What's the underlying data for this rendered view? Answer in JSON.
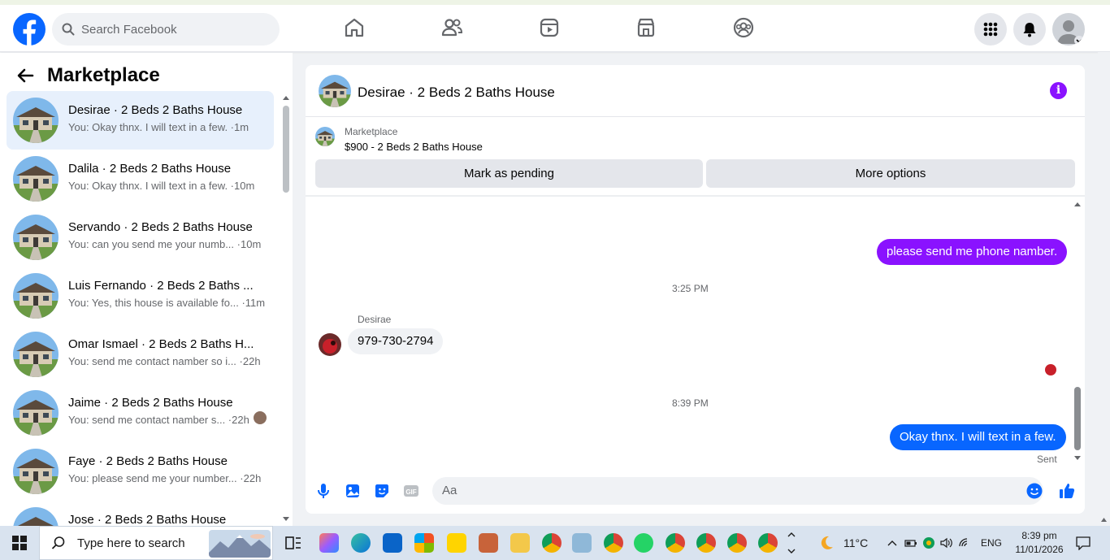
{
  "topbar": {
    "search_placeholder": "Search Facebook"
  },
  "left": {
    "title": "Marketplace",
    "conversations": [
      {
        "name": "Desirae · 2 Beds 2 Baths House",
        "preview": "You: Okay thnx. I will text in a few.",
        "time": "1m",
        "active": true
      },
      {
        "name": "Dalila · 2 Beds 2 Baths House",
        "preview": "You: Okay thnx. I will text in a few.",
        "time": "10m"
      },
      {
        "name": "Servando · 2 Beds 2 Baths House",
        "preview": "You: can you send me your numb...",
        "time": "10m"
      },
      {
        "name": "Luis Fernando · 2 Beds 2 Baths ...",
        "preview": "You: Yes, this house is available fo...",
        "time": "11m"
      },
      {
        "name": "Omar Ismael · 2 Beds 2 Baths H...",
        "preview": "You: send me contact namber so i...",
        "time": "22h"
      },
      {
        "name": "Jaime · 2 Beds 2 Baths House",
        "preview": "You: send me contact namber s...",
        "time": "22h"
      },
      {
        "name": "Faye · 2 Beds 2 Baths House",
        "preview": "You: please send me your number...",
        "time": "22h"
      },
      {
        "name": "Jose · 2 Beds 2 Baths House",
        "preview": "",
        "time": ""
      }
    ]
  },
  "chat": {
    "title": "Desirae · 2 Beds 2 Baths House",
    "marketplace_label": "Marketplace",
    "listing": "$900 - 2 Beds 2 Baths House",
    "mark_pending": "Mark as pending",
    "more_options": "More options",
    "messages": {
      "out1": "please send me phone namber.",
      "time1": "3:25 PM",
      "sender": "Desirae",
      "in1": "979-730-2794",
      "time2": "8:39 PM",
      "out2": "Okay thnx. I will text in a few.",
      "status": "Sent"
    },
    "input_placeholder": "Aa"
  },
  "taskbar": {
    "search_placeholder": "Type here to search",
    "temperature": "11°C",
    "language": "ENG",
    "time": "8:39 pm",
    "date": "11/01/2026"
  },
  "colors": {
    "fb_blue": "#0866ff",
    "purple": "#8a12ff",
    "active_row": "#e7f0fc"
  }
}
